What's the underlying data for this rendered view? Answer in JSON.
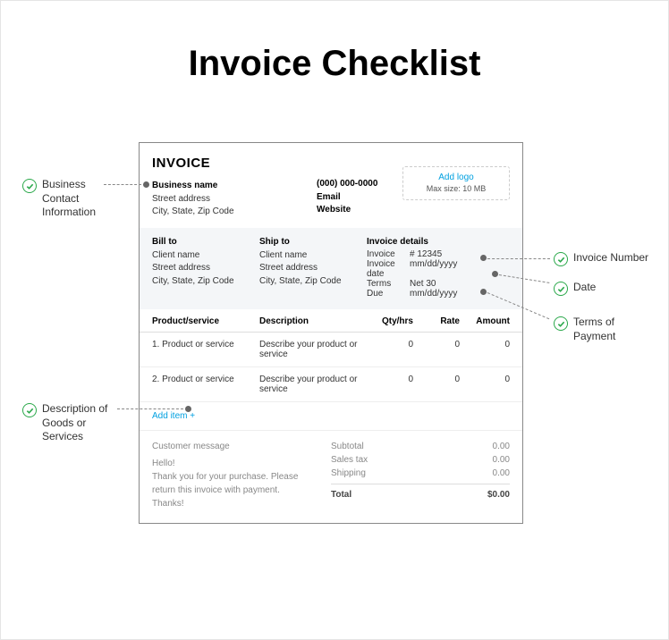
{
  "title": "Invoice Checklist",
  "invoice": {
    "header_title": "INVOICE",
    "business_name": "Business name",
    "street": "Street address",
    "csz": "City, State, Zip Code",
    "phone": "(000) 000-0000",
    "email": "Email",
    "website": "Website",
    "add_logo": "Add logo",
    "max_size": "Max size: 10 MB"
  },
  "billto": {
    "title": "Bill to",
    "client": "Client name",
    "street": "Street address",
    "csz": "City, State, Zip Code"
  },
  "shipto": {
    "title": "Ship to",
    "client": "Client name",
    "street": "Street address",
    "csz": "City, State, Zip Code"
  },
  "details": {
    "title": "Invoice details",
    "inv_k": "Invoice",
    "inv_v": "# 12345",
    "date_k": "Invoice date",
    "date_v": "mm/dd/yyyy",
    "terms_k": "Terms",
    "terms_v": "Net 30",
    "due_k": "Due",
    "due_v": "mm/dd/yyyy"
  },
  "table": {
    "h_prod": "Product/service",
    "h_desc": "Description",
    "h_qty": "Qty/hrs",
    "h_rate": "Rate",
    "h_amt": "Amount",
    "rows": [
      {
        "prod": "1. Product or service",
        "desc": "Describe your product or service",
        "qty": "0",
        "rate": "0",
        "amt": "0"
      },
      {
        "prod": "2. Product or service",
        "desc": "Describe your product or service",
        "qty": "0",
        "rate": "0",
        "amt": "0"
      }
    ],
    "add": "Add item +"
  },
  "footer": {
    "cust_title": "Customer message",
    "cust_body": "Hello!\nThank you for your purchase. Please return this invoice with payment.\nThanks!",
    "subtotal_k": "Subtotal",
    "subtotal_v": "0.00",
    "tax_k": "Sales tax",
    "tax_v": "0.00",
    "ship_k": "Shipping",
    "ship_v": "0.00",
    "total_k": "Total",
    "total_v": "$0.00"
  },
  "callouts": {
    "biz": "Business\nContact\nInformation",
    "goods": "Description of\nGoods or\nServices",
    "invno": "Invoice Number",
    "date": "Date",
    "terms": "Terms of\nPayment"
  }
}
